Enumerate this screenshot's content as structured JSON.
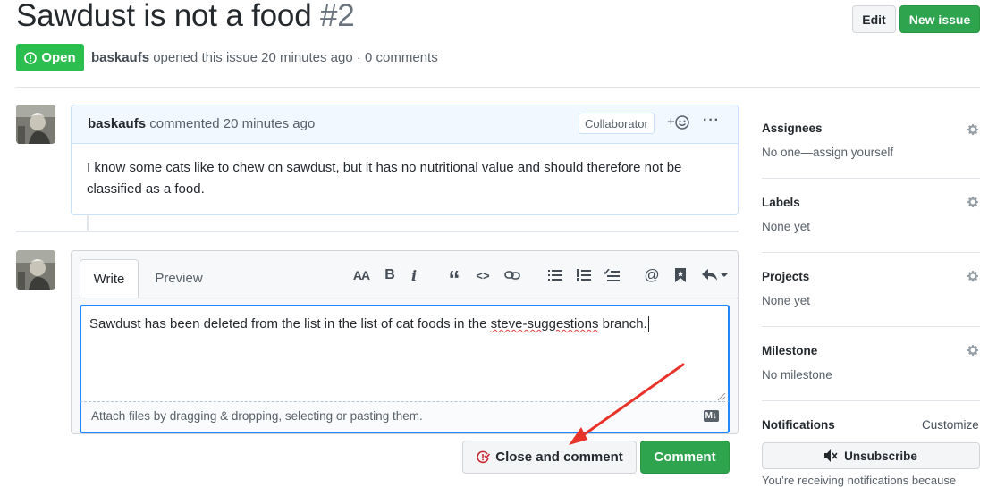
{
  "issue": {
    "title": "Sawdust is not a food",
    "number": "#2",
    "state": "Open",
    "author": "baskaufs",
    "meta_text": "opened this issue 20 minutes ago · 0 comments"
  },
  "header": {
    "edit_label": "Edit",
    "new_issue_label": "New issue"
  },
  "comment": {
    "author": "baskaufs",
    "time_text": "commented 20 minutes ago",
    "badge": "Collaborator",
    "reaction_plus": "+",
    "more": "···",
    "body": "I know some cats like to chew on sawdust, but it has no nutritional value and should therefore not be classified as a food."
  },
  "editor": {
    "tab_write": "Write",
    "tab_preview": "Preview",
    "text_before": "Sawdust has been deleted from the list in the list of cat foods in the ",
    "text_misspelled": "steve-suggestions",
    "text_after": " branch.",
    "attach_hint": "Attach files by dragging & dropping, selecting or pasting them.",
    "md_badge": "M↓",
    "toolbar": {
      "heading": "AA",
      "bold": "B",
      "italic": "i",
      "quote": "“",
      "code": "<>",
      "mention": "@"
    },
    "close_comment_label": "Close and comment",
    "comment_label": "Comment"
  },
  "sidebar": {
    "assignees_label": "Assignees",
    "assignees_value": "No one—assign yourself",
    "labels_label": "Labels",
    "labels_value": "None yet",
    "projects_label": "Projects",
    "projects_value": "None yet",
    "milestone_label": "Milestone",
    "milestone_value": "No milestone",
    "notifications_label": "Notifications",
    "customize_label": "Customize",
    "unsubscribe_label": "Unsubscribe",
    "notif_text": "You’re receiving notifications because"
  },
  "colors": {
    "green": "#2cbe4e",
    "blue_focus": "#2188ff",
    "annotation_arrow": "#e8332a"
  }
}
